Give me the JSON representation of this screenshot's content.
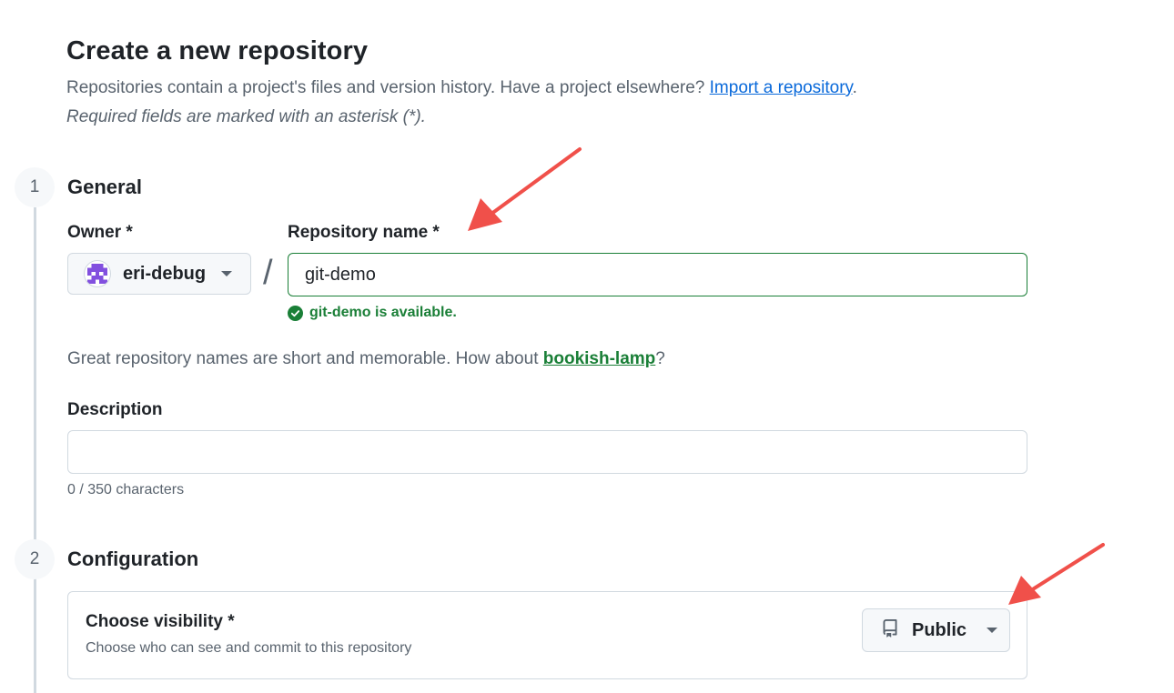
{
  "header": {
    "title": "Create a new repository",
    "subtitle_text": "Repositories contain a project's files and version history. Have a project elsewhere?",
    "import_link": "Import a repository",
    "subtitle_end": ".",
    "required_note": "Required fields are marked with an asterisk (*)."
  },
  "general": {
    "step_number": "1",
    "title": "General",
    "owner_label": "Owner *",
    "owner_value": "eri-debug",
    "separator": "/",
    "repo_name_label": "Repository name *",
    "repo_name_value": "git-demo",
    "availability": "git-demo is available.",
    "suggestion_text": "Great repository names are short and memorable. How about",
    "suggestion_name": "bookish-lamp",
    "suggestion_end": "?",
    "description_label": "Description",
    "description_value": "",
    "char_count": "0 / 350 characters"
  },
  "configuration": {
    "step_number": "2",
    "title": "Configuration",
    "visibility_title": "Choose visibility *",
    "visibility_desc": "Choose who can see and commit to this repository",
    "visibility_value": "Public"
  },
  "colors": {
    "accent_success": "#1a7f37",
    "link": "#0969da",
    "annotation_arrow": "#f0504a",
    "avatar": "#8250df"
  },
  "icons": {
    "owner_avatar": "identicon-avatar",
    "availability": "check-circle-icon",
    "visibility": "repo-icon",
    "dropdown": "triangle-down-icon"
  }
}
